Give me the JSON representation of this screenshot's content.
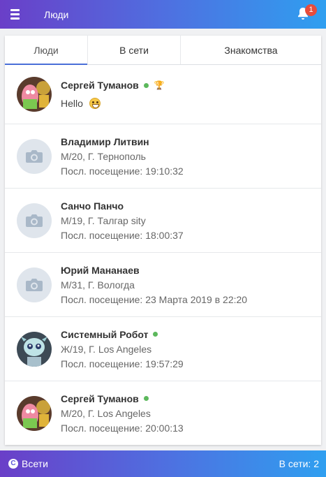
{
  "header": {
    "title": "Люди",
    "notifications": "1"
  },
  "tabs": [
    {
      "label": "Люди"
    },
    {
      "label": "В сети"
    },
    {
      "label": "Знакомства"
    }
  ],
  "people": [
    {
      "name": "Сергей Туманов",
      "online": true,
      "trophy": true,
      "status": "Hello",
      "avatar": "patrick-icon"
    },
    {
      "name": "Владимир Литвин",
      "line1": "М/20, Г. Тернополь",
      "line2": "Посл. посещение: 19:10:32",
      "avatar": "camera-icon"
    },
    {
      "name": "Санчо Панчо",
      "line1": "М/19, Г. Талгар sity",
      "line2": "Посл. посещение: 18:00:37",
      "avatar": "camera-icon"
    },
    {
      "name": "Юрий Мананаев",
      "line1": "М/31, Г. Вологда",
      "line2": "Посл. посещение: 23 Марта 2019 в 22:20",
      "avatar": "camera-icon"
    },
    {
      "name": "Системный Робот",
      "online": true,
      "line1": "Ж/19, Г. Los Angeles",
      "line2": "Посл. посещение: 19:57:29",
      "avatar": "robot-icon"
    },
    {
      "name": "Сергей Туманов",
      "online": true,
      "line1": "М/20, Г. Los Angeles",
      "line2": "Посл. посещение: 20:00:13",
      "avatar": "patrick-icon"
    }
  ],
  "footer": {
    "brand": "Всети",
    "brand_letter": "C",
    "online_count": "В сети: 2"
  },
  "colors": {
    "accent": "#4a6fd8",
    "online": "#5cb85c",
    "badge": "#e74c3c"
  }
}
